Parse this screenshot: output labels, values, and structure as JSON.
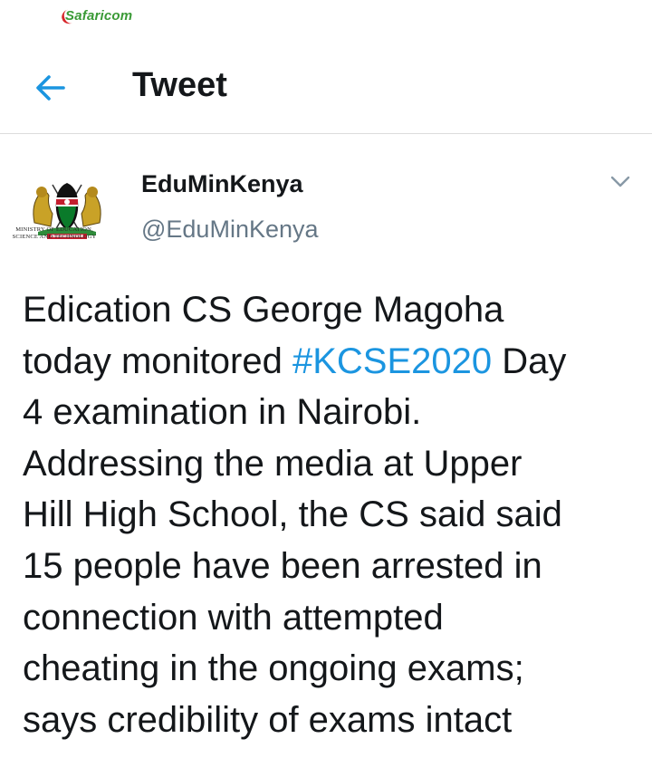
{
  "status_bar": {
    "carrier": "Safaricom"
  },
  "header": {
    "back_icon": "arrow-left-icon",
    "title": "Tweet"
  },
  "tweet": {
    "avatar": {
      "icon": "kenya-coat-of-arms-icon",
      "caption": "MINISTRY OF EDUCATION, SCIENCE AND TECHNOLOGY"
    },
    "author_name": "EduMinKenya",
    "author_handle": "@EduMinKenya",
    "menu_icon": "chevron-down-icon",
    "body": {
      "line1": "Edication CS George Magoha",
      "line2_before": "today monitored ",
      "hashtag": "#KCSE2020",
      "line2_after": " Day",
      "line3": "4 examination in Nairobi.",
      "line4": "Addressing the media at Upper",
      "line5": "Hill High School, the CS said said",
      "line6": "15 people have been arrested in",
      "line7": "connection with attempted",
      "line8": "cheating in the ongoing exams;",
      "line9": "says credibility of exams intact"
    }
  },
  "colors": {
    "accent": "#1b95e0",
    "handle": "#657786",
    "text": "#14171a",
    "carrier": "#3a9a36",
    "divider": "#dcdcdc"
  }
}
